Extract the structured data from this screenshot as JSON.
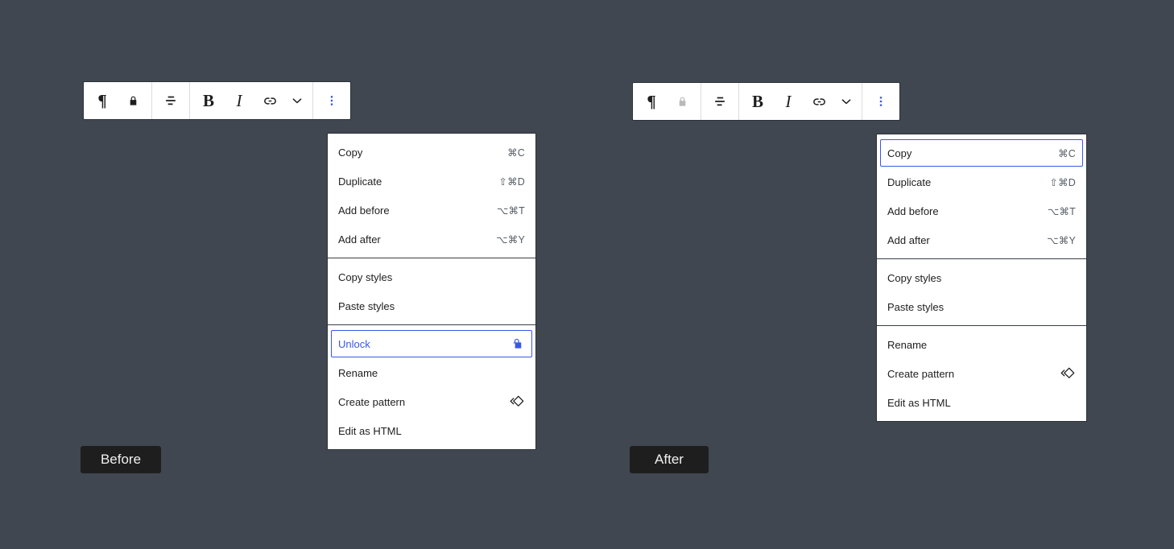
{
  "background_color": "#414751",
  "accent_color": "#3858e9",
  "panels": [
    {
      "id": "before",
      "caption": "Before",
      "toolbar": {
        "groups": [
          {
            "buttons": [
              {
                "name": "paragraph-icon",
                "glyph": "¶",
                "state": "default"
              },
              {
                "name": "lock-icon",
                "glyph": "lock",
                "state": "default"
              }
            ]
          },
          {
            "buttons": [
              {
                "name": "align-left-icon",
                "glyph": "align-left",
                "state": "default"
              }
            ]
          },
          {
            "buttons": [
              {
                "name": "bold-icon",
                "glyph": "B",
                "state": "default"
              },
              {
                "name": "italic-icon",
                "glyph": "I",
                "state": "default"
              },
              {
                "name": "link-icon",
                "glyph": "link",
                "state": "default"
              },
              {
                "name": "chevron-down-icon",
                "glyph": "chevron-down",
                "state": "default"
              }
            ]
          },
          {
            "buttons": [
              {
                "name": "more-options-icon",
                "glyph": "kebab",
                "state": "active"
              }
            ]
          }
        ]
      },
      "menu": {
        "sections": [
          {
            "items": [
              {
                "label": "Copy",
                "shortcut": "⌘C",
                "icon": "",
                "focus": "none"
              },
              {
                "label": "Duplicate",
                "shortcut": "⇧⌘D",
                "icon": "",
                "focus": "none"
              },
              {
                "label": "Add before",
                "shortcut": "⌥⌘T",
                "icon": "",
                "focus": "none"
              },
              {
                "label": "Add after",
                "shortcut": "⌥⌘Y",
                "icon": "",
                "focus": "none"
              }
            ]
          },
          {
            "items": [
              {
                "label": "Copy styles",
                "shortcut": "",
                "icon": "",
                "focus": "none"
              },
              {
                "label": "Paste styles",
                "shortcut": "",
                "icon": "",
                "focus": "none"
              }
            ]
          },
          {
            "items": [
              {
                "label": "Unlock",
                "shortcut": "",
                "icon": "unlock",
                "focus": "blue"
              },
              {
                "label": "Rename",
                "shortcut": "",
                "icon": "",
                "focus": "none"
              },
              {
                "label": "Create pattern",
                "shortcut": "",
                "icon": "pattern",
                "focus": "none"
              },
              {
                "label": "Edit as HTML",
                "shortcut": "",
                "icon": "",
                "focus": "none"
              }
            ]
          }
        ]
      }
    },
    {
      "id": "after",
      "caption": "After",
      "toolbar": {
        "groups": [
          {
            "buttons": [
              {
                "name": "paragraph-icon",
                "glyph": "¶",
                "state": "default"
              },
              {
                "name": "lock-icon",
                "glyph": "lock",
                "state": "disabled"
              }
            ]
          },
          {
            "buttons": [
              {
                "name": "align-left-icon",
                "glyph": "align-left",
                "state": "default"
              }
            ]
          },
          {
            "buttons": [
              {
                "name": "bold-icon",
                "glyph": "B",
                "state": "default"
              },
              {
                "name": "italic-icon",
                "glyph": "I",
                "state": "default"
              },
              {
                "name": "link-icon",
                "glyph": "link",
                "state": "default"
              },
              {
                "name": "chevron-down-icon",
                "glyph": "chevron-down",
                "state": "default"
              }
            ]
          },
          {
            "buttons": [
              {
                "name": "more-options-icon",
                "glyph": "kebab",
                "state": "active"
              }
            ]
          }
        ]
      },
      "menu": {
        "sections": [
          {
            "items": [
              {
                "label": "Copy",
                "shortcut": "⌘C",
                "icon": "",
                "focus": "ring"
              },
              {
                "label": "Duplicate",
                "shortcut": "⇧⌘D",
                "icon": "",
                "focus": "none"
              },
              {
                "label": "Add before",
                "shortcut": "⌥⌘T",
                "icon": "",
                "focus": "none"
              },
              {
                "label": "Add after",
                "shortcut": "⌥⌘Y",
                "icon": "",
                "focus": "none"
              }
            ]
          },
          {
            "items": [
              {
                "label": "Copy styles",
                "shortcut": "",
                "icon": "",
                "focus": "none"
              },
              {
                "label": "Paste styles",
                "shortcut": "",
                "icon": "",
                "focus": "none"
              }
            ]
          },
          {
            "items": [
              {
                "label": "Rename",
                "shortcut": "",
                "icon": "",
                "focus": "none"
              },
              {
                "label": "Create pattern",
                "shortcut": "",
                "icon": "pattern",
                "focus": "none"
              },
              {
                "label": "Edit as HTML",
                "shortcut": "",
                "icon": "",
                "focus": "none"
              }
            ]
          }
        ]
      }
    }
  ]
}
